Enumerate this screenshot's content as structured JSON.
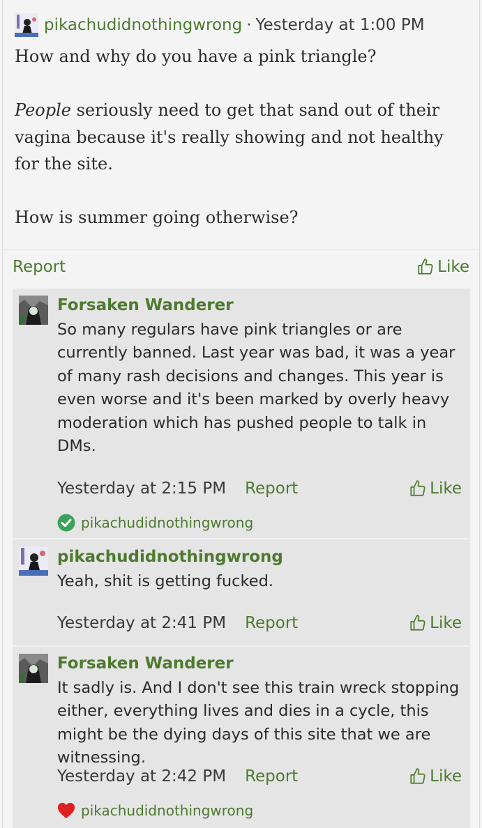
{
  "post": {
    "author": "pikachudidnothingwrong",
    "separator": "·",
    "timestamp": "Yesterday at 1:00 PM",
    "line1": "How and why do you have a pink triangle?",
    "emph": "People",
    "line2_rest": " seriously need to get that sand out of their vagina because it's really showing and not healthy for the site.",
    "line3": "How is summer going otherwise?",
    "report_label": "Report",
    "like_label": "Like"
  },
  "comments": [
    {
      "author": "Forsaken Wanderer",
      "text": "So many regulars have pink triangles or are currently banned. Last year was bad, it was a year of many rash decisions and changes. This year is even worse and it's been marked by overly heavy moderation which has pushed people to talk in DMs.",
      "timestamp": "Yesterday at 2:15 PM",
      "report_label": "Report",
      "like_label": "Like",
      "reaction_user": "pikachudidnothingwrong",
      "reaction_icon": "check-circle-icon"
    },
    {
      "author": "pikachudidnothingwrong",
      "text": "Yeah, shit is getting fucked.",
      "timestamp": "Yesterday at 2:41 PM",
      "report_label": "Report",
      "like_label": "Like"
    },
    {
      "author": "Forsaken Wanderer",
      "text": "It sadly is. And I don't see this train wreck stopping either, everything lives and dies in a cycle, this might be the dying days of this site that we are witnessing.",
      "timestamp": "Yesterday at 2:42 PM",
      "report_label": "Report",
      "like_label": "Like",
      "reaction_user": "pikachudidnothingwrong",
      "reaction_icon": "heart-icon"
    }
  ],
  "colors": {
    "link_green": "#4d7a2f",
    "comment_bg": "#e5e5e5",
    "page_bg": "#f4f4f4",
    "check_green": "#3aa35a",
    "heart_red": "#e02020"
  }
}
